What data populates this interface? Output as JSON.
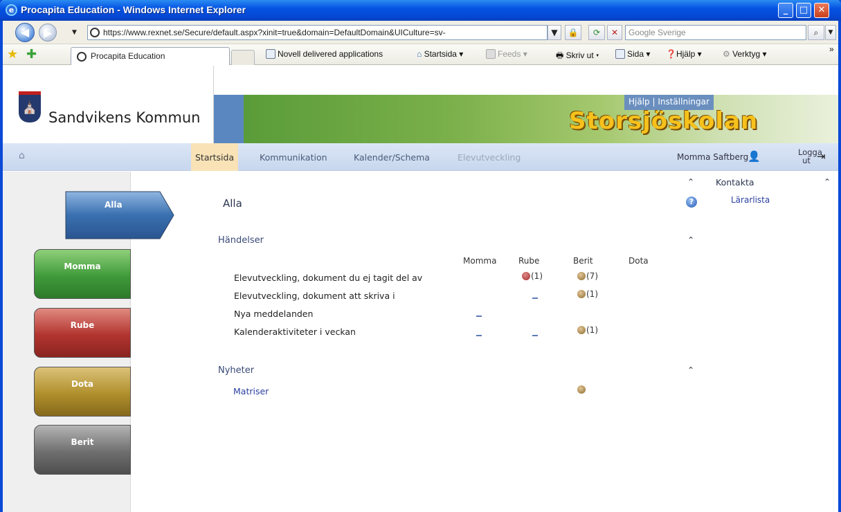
{
  "window": {
    "title": "Procapita Education - Windows Internet Explorer"
  },
  "address": {
    "url": "https://www.rexnet.se/Secure/default.aspx?xinit=true&domain=DefaultDomain&UICulture=sv-",
    "search_placeholder": "Google Sverige"
  },
  "toolbar": {
    "tab_label": "Procapita Education",
    "novell": "Novell delivered applications",
    "startsida": "Startsida",
    "feeds": "Feeds",
    "skriv_ut": "Skriv ut",
    "sida": "Sida",
    "hjalp": "Hjälp",
    "verktyg": "Verktyg"
  },
  "banner": {
    "municipality": "Sandvikens Kommun",
    "school": "Storsjöskolan",
    "toplinks": "Hjälp | Inställningar"
  },
  "nav": {
    "items": [
      {
        "label": "Startsida"
      },
      {
        "label": "Kommunikation"
      },
      {
        "label": "Kalender/Schema"
      },
      {
        "label": "Elevutveckling"
      }
    ],
    "user": "Momma Saftberg",
    "logout": "Logga ut"
  },
  "sidebar": {
    "tabs": [
      {
        "label": "Alla"
      },
      {
        "label": "Momma"
      },
      {
        "label": "Rube"
      },
      {
        "label": "Dota"
      },
      {
        "label": "Berit"
      }
    ]
  },
  "main": {
    "title": "Alla",
    "events": {
      "heading": "Händelser",
      "columns": [
        "Momma",
        "Rube",
        "Berit",
        "Dota"
      ],
      "rows": [
        {
          "label": "Elevutveckling, dokument du ej tagit del av",
          "rube": "(1)",
          "berit": "(7)"
        },
        {
          "label": "Elevutveckling, dokument att skriva i",
          "berit": "(1)"
        },
        {
          "label": "Nya meddelanden"
        },
        {
          "label": "Kalenderaktiviteter i veckan",
          "berit": "(1)"
        }
      ]
    },
    "news": {
      "heading": "Nyheter",
      "items": [
        {
          "label": "Matriser"
        }
      ]
    },
    "contact": {
      "heading": "Kontakta",
      "link": "Lärarlista"
    }
  },
  "colors": {
    "nav_active": "#f8e2b6",
    "momma": "#3f9a3a",
    "rube": "#b2342f",
    "dota": "#b08f2c",
    "berit": "#6e6e6e",
    "alla": "#3a70b0"
  }
}
